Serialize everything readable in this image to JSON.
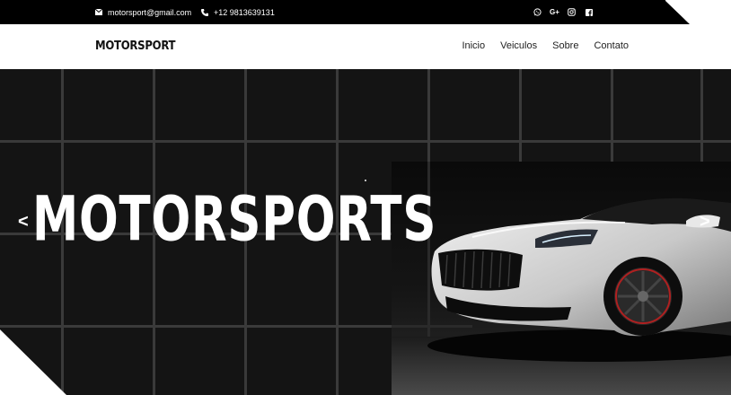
{
  "topbar": {
    "email": "motorsport@gmail.com",
    "phone": "+12 9813639131",
    "social": [
      {
        "icon": "whatsapp-icon"
      },
      {
        "icon": "google-plus-icon",
        "glyph": "G+"
      },
      {
        "icon": "instagram-icon"
      },
      {
        "icon": "facebook-icon",
        "glyph": "f"
      }
    ]
  },
  "navbar": {
    "brand": "MOTORSPORT",
    "menu": [
      "Inicio",
      "Veiculos",
      "Sobre",
      "Contato"
    ]
  },
  "hero": {
    "title": "MOTORSPORTS",
    "prev": "<",
    "next": ">"
  },
  "colors": {
    "topbar": "#000000",
    "hero_bg": "#141414",
    "grid": "#3a3a3a",
    "text_light": "#ffffff",
    "text_dark": "#222222"
  }
}
